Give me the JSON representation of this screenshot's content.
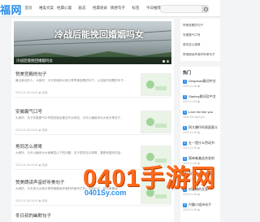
{
  "header": {
    "logo": "福网",
    "nav": [
      "首页",
      "唯美文案",
      "经典心理",
      "励志",
      "经典语录",
      "情感句子",
      "标签",
      "今日推荐"
    ]
  },
  "banner": {
    "title": "冷战后能挽回婚姻吗女",
    "caption": "冷战后能挽回婚姻吗女"
  },
  "articles": [
    {
      "title": "赞美宫殿的句子",
      "summary": "最近身边的人，大家好，今天来就和大家分享赞美宫殿的句子，以及描写宫殿的句子...",
      "meta": "2023-11-08 00:00  ◉ 阅读"
    },
    {
      "title": "安徽霸气口号",
      "summary": "大家好，关于安徽霸气口号很多朋友都还不太明白，今天小编就来为大家分享关于...",
      "meta": "2023-11-08 00:00  ◉ 阅读"
    },
    {
      "title": "男同怎么撩哥",
      "summary": "大家好，今天小编来为大家解答以下的问题，关于男同怎么撩哥，要是有疑问的话...",
      "meta": "2023-11-08 00:00  ◉ 阅读"
    },
    {
      "title": "赞美朗读声音好听美句子",
      "summary": "大家好，今天来为大家分享赞美朗读声音好听美句子的一些知识点，和赞美朗读...",
      "meta": "2023-11-08 00:00  ◉ 阅读"
    },
    {
      "title": "冬日叔的幽默句子",
      "summary": "",
      "meta": ""
    }
  ],
  "sidebar": {
    "top_links": [
      "赞美宫殿的句子",
      "安徽霸气口号",
      "男同怎么撩哥",
      "赞美朗读声音好听美句子"
    ],
    "hot_heading": "热门",
    "hot": [
      {
        "rank": "1",
        "title": "Despacito歌词中文",
        "sub": "2023-11-08 ◉"
      },
      {
        "rank": "2",
        "title": "Starboy歌词及中文",
        "sub": "2023-11-08 ◉"
      },
      {
        "rank": "3",
        "title": "Love me like you",
        "sub": "Stole the light you..."
      },
      {
        "rank": "4",
        "title": "四大爆仔的表面意义",
        "sub": "2023-11-08 ◉"
      },
      {
        "rank": "5",
        "title": "五一是什么劳动节",
        "sub": "2023-11-08 ◉"
      },
      {
        "rank": "6",
        "title": "简单唯美适合发的",
        "sub": "2023-11-08 ◉"
      },
      {
        "rank": "7",
        "title": "哥哥的礼物女孩子",
        "sub": "2023-11-08 ◉"
      },
      {
        "rank": "8",
        "title": "对爱情的文案",
        "sub": "2023-11-08 ◉"
      },
      {
        "rank": "9",
        "title": "兴趣小组诗句子",
        "sub": "2023-11-08 ◉"
      }
    ]
  },
  "watermark": {
    "main": "0401手游网",
    "sub": "0401Sy.com"
  }
}
